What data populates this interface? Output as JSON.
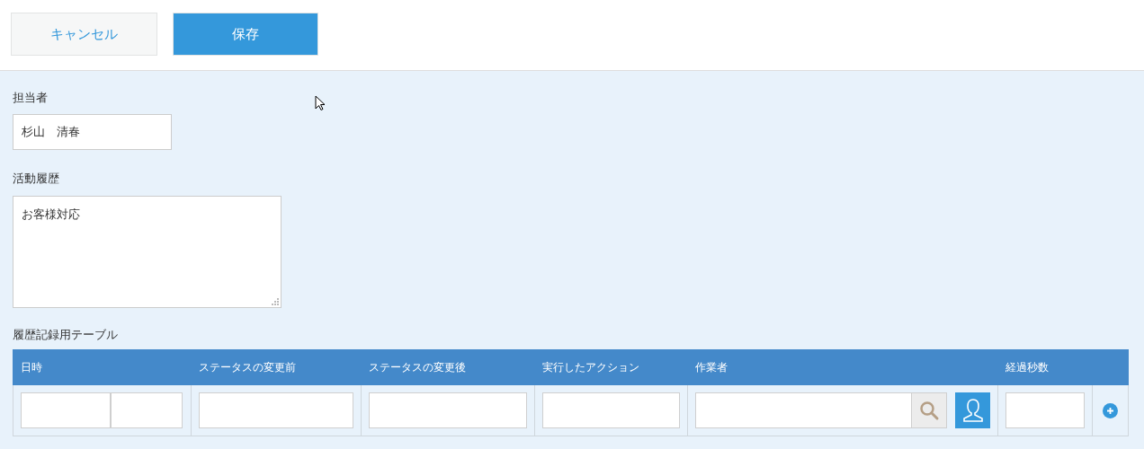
{
  "toolbar": {
    "cancel": "キャンセル",
    "save": "保存"
  },
  "assignee": {
    "label": "担当者",
    "value": "杉山　清春"
  },
  "history": {
    "label": "活動履歴",
    "value": "お客様対応"
  },
  "table": {
    "title": "履歴記録用テーブル",
    "columns": [
      "日時",
      "ステータスの変更前",
      "ステータスの変更後",
      "実行したアクション",
      "作業者",
      "経過秒数"
    ]
  }
}
